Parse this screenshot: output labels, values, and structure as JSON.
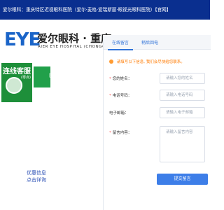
{
  "header": {
    "title": "爱尔眼科：重庆特区近视眼科医院（爱尔·麦格·爱瑞斯丽·眼视光眼科医院）【官网】"
  },
  "logo": {
    "mark": "EYE",
    "name": "爱尔眼科 · 重庆",
    "en": "AIER EYE HOSPITAL (CHONGQING)"
  },
  "widget": {
    "title": "连线客服",
    "subtitle": "(零点)",
    "side_label": "医院"
  },
  "left_bottom": {
    "line1": "优惠信息",
    "line2": "点击详询"
  },
  "chat": {
    "tabs": [
      {
        "label": "在线留言"
      },
      {
        "label": "稍后回电"
      }
    ],
    "notice": "请填写以下信息, 我们会尽快给您联系。",
    "fields": {
      "name": {
        "label": "您的姓名：",
        "placeholder": "请输入您的姓名"
      },
      "phone": {
        "label": "电话号码：",
        "placeholder": "请输入电话号码"
      },
      "email": {
        "label": "电子邮箱：",
        "placeholder": "请输入电子邮箱"
      },
      "message": {
        "label": "留言内容：",
        "placeholder": "请输入留言内容"
      }
    },
    "submit_label": "提交留言"
  },
  "colors": {
    "topbar": "#0a2f8f",
    "brand_blue": "#1a64c8",
    "green": "#21a04a",
    "accent": "#3d7ee8"
  }
}
